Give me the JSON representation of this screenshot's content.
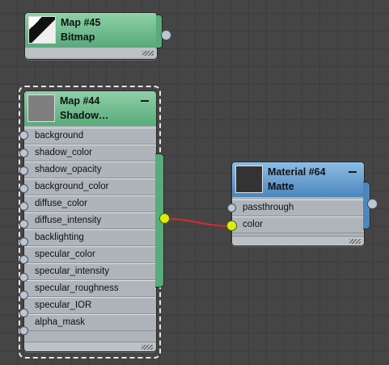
{
  "nodes": {
    "map45": {
      "title_line1": "Map #45",
      "title_line2": "Bitmap",
      "thumbnail": "bitmap-preview"
    },
    "map44": {
      "title_line1": "Map #44",
      "title_line2": "Shadow…",
      "thumbnail": "gray-swatch",
      "inputs": [
        "background",
        "shadow_color",
        "shadow_opacity",
        "background_color",
        "diffuse_color",
        "diffuse_intensity",
        "backlighting",
        "specular_color",
        "specular_intensity",
        "specular_roughness",
        "specular_IOR",
        "alpha_mask"
      ]
    },
    "material64": {
      "title_line1": "Material #64",
      "title_line2": "Matte",
      "thumbnail": "dark-swatch",
      "inputs": [
        "passthrough",
        "color"
      ]
    }
  },
  "colors": {
    "map_header": "#58ab7a",
    "material_header": "#4c86bc",
    "wire": "#e0282a",
    "active_port": "#d7f010"
  },
  "connections": [
    {
      "from": "Map #44 output",
      "to": "Material #64 color"
    }
  ]
}
